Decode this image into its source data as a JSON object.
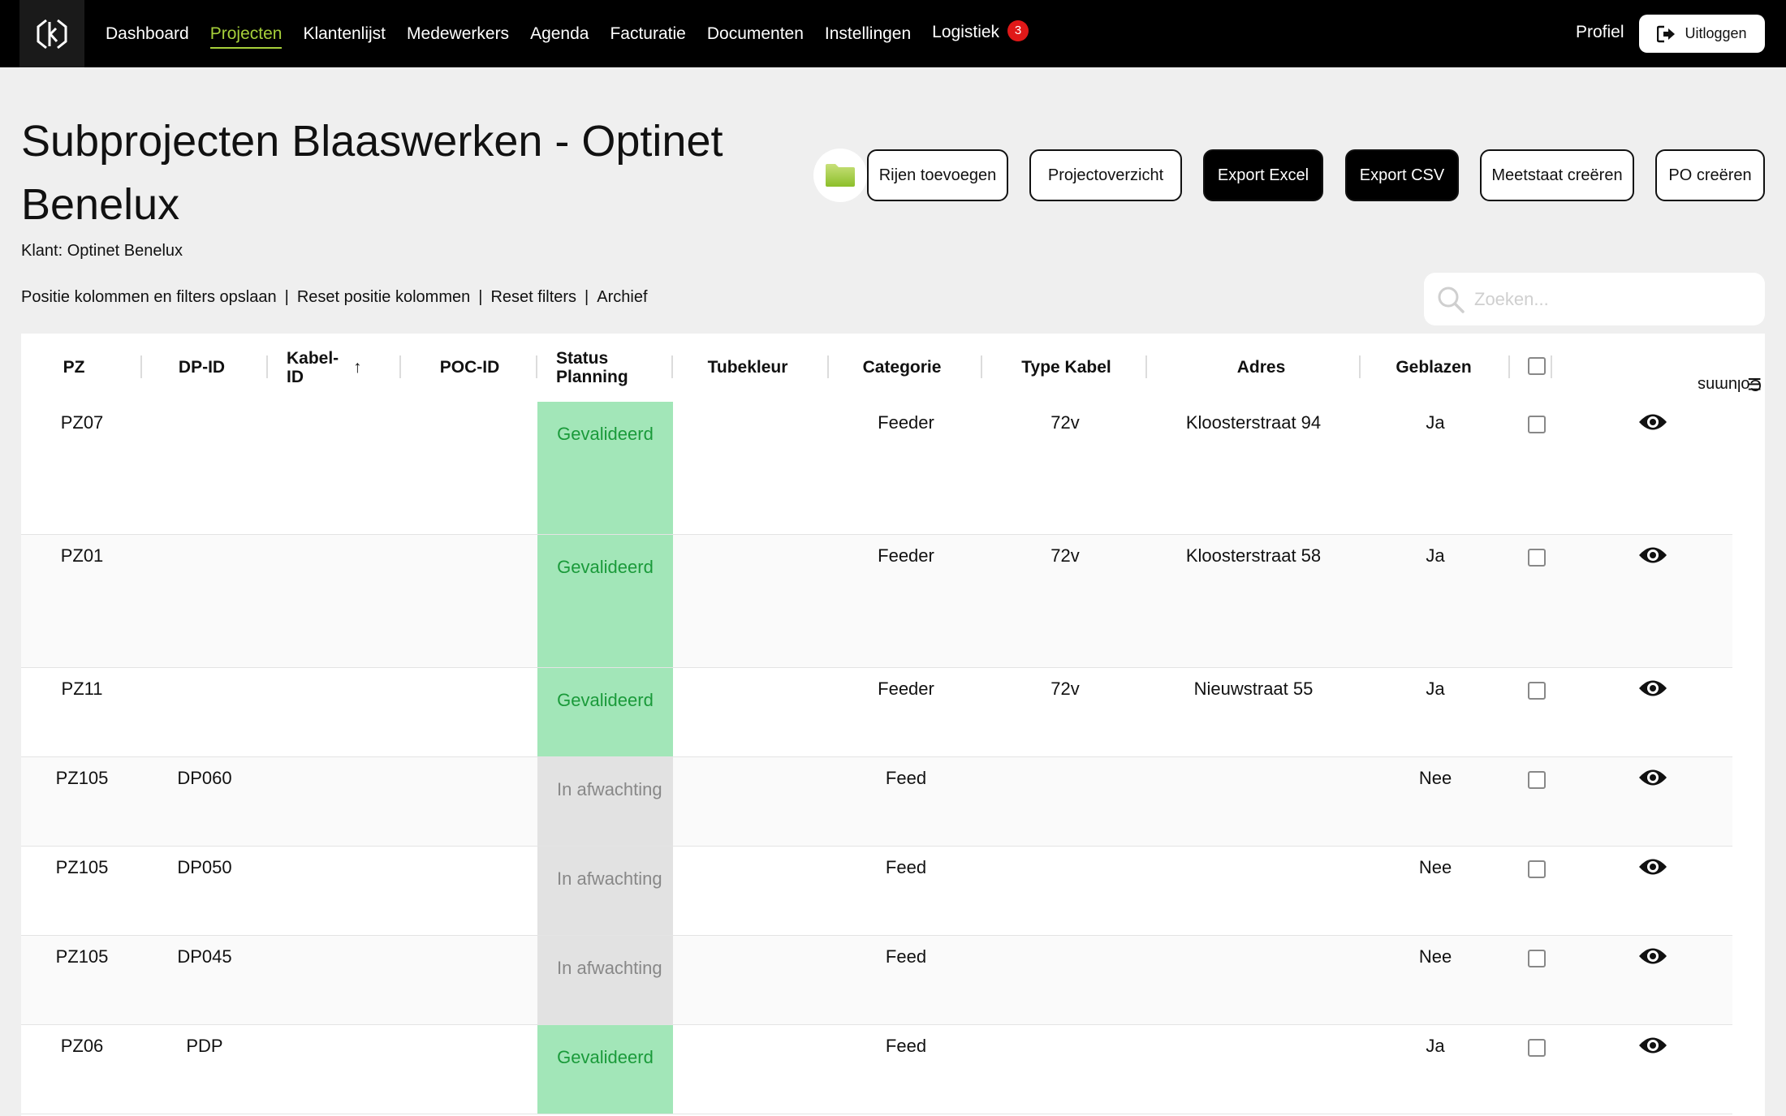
{
  "nav": {
    "items": [
      {
        "label": "Dashboard",
        "active": false
      },
      {
        "label": "Projecten",
        "active": true
      },
      {
        "label": "Klantenlijst",
        "active": false
      },
      {
        "label": "Medewerkers",
        "active": false
      },
      {
        "label": "Agenda",
        "active": false
      },
      {
        "label": "Facturatie",
        "active": false
      },
      {
        "label": "Documenten",
        "active": false
      },
      {
        "label": "Instellingen",
        "active": false
      },
      {
        "label": "Logistiek",
        "active": false
      }
    ],
    "logistiek_badge": "3",
    "profile": "Profiel",
    "logout": "Uitloggen"
  },
  "header": {
    "title": "Subprojecten Blaaswerken - Optinet Benelux",
    "client": "Klant: Optinet Benelux"
  },
  "toolbar": {
    "add_rows": "Rijen toevoegen",
    "project_overview": "Projectoverzicht",
    "export_excel": "Export Excel",
    "export_csv": "Export CSV",
    "meetstaat": "Meetstaat creëren",
    "po": "PO creëren"
  },
  "links": {
    "save_layout": "Positie kolommen en filters opslaan",
    "reset_columns": "Reset positie kolommen",
    "reset_filters": "Reset filters",
    "archive": "Archief",
    "separator": "|"
  },
  "search": {
    "placeholder": "Zoeken..."
  },
  "table": {
    "columns": [
      "PZ",
      "DP-ID",
      "Kabel-ID",
      "POC-ID",
      "Status Planning",
      "Tubekleur",
      "Categorie",
      "Type Kabel",
      "Adres",
      "Geblazen"
    ],
    "sort_indicator": "↑",
    "columns_panel": "Columns",
    "rows": [
      {
        "pz": "PZ07",
        "dp": "",
        "status": "Gevalideerd",
        "categorie": "Feeder",
        "type": "72v",
        "adres": "Kloosterstraat 94",
        "geblazen": "Ja"
      },
      {
        "pz": "PZ01",
        "dp": "",
        "status": "Gevalideerd",
        "categorie": "Feeder",
        "type": "72v",
        "adres": "Kloosterstraat 58",
        "geblazen": "Ja"
      },
      {
        "pz": "PZ11",
        "dp": "",
        "status": "Gevalideerd",
        "categorie": "Feeder",
        "type": "72v",
        "adres": "Nieuwstraat 55",
        "geblazen": "Ja"
      },
      {
        "pz": "PZ105",
        "dp": "DP060",
        "status": "In afwachting",
        "categorie": "Feed",
        "type": "",
        "adres": "",
        "geblazen": "Nee"
      },
      {
        "pz": "PZ105",
        "dp": "DP050",
        "status": "In afwachting",
        "categorie": "Feed",
        "type": "",
        "adres": "",
        "geblazen": "Nee"
      },
      {
        "pz": "PZ105",
        "dp": "DP045",
        "status": "In afwachting",
        "categorie": "Feed",
        "type": "",
        "adres": "",
        "geblazen": "Nee"
      },
      {
        "pz": "PZ06",
        "dp": "PDP",
        "status": "Gevalideerd",
        "categorie": "Feed",
        "type": "",
        "adres": "",
        "geblazen": "Ja"
      }
    ]
  },
  "colors": {
    "accent": "#a6cf3a",
    "validated_bg": "#a2e6b8",
    "validated_text": "#1a9a3a",
    "pending_bg": "#e2e2e2",
    "badge": "#e01818"
  },
  "icons": [
    "logo-icon",
    "logout-icon",
    "folder-icon",
    "search-icon",
    "eye-icon",
    "sort-up-icon",
    "columns-icon"
  ]
}
